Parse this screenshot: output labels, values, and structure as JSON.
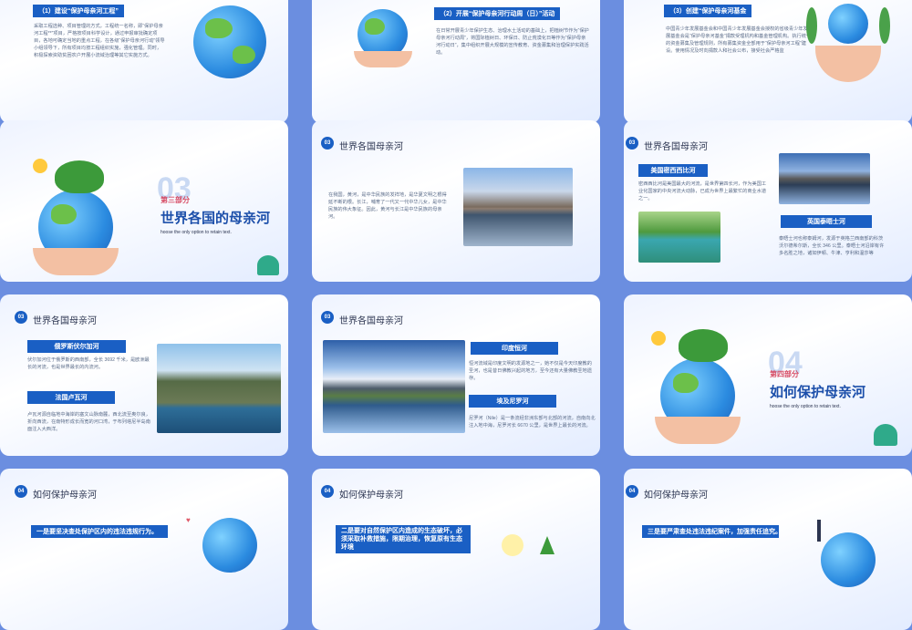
{
  "slides": {
    "s1": {
      "ribbon": "（1）建设“保护母亲河工程”",
      "text": "采取工程选种、项目管理的方式，工程统一名称，即“保护母亲河工程**”项目，严格按项目科学设计，通过申报审批确定项目，各地可确定当地的重点工程，在各级“保护母亲河行动”领导小组领导下，所有项目均按工程组织实施，强化管理。同时，积极探索资助贫困农户开展小流域治理等其它实施方式。"
    },
    "s2": {
      "ribbon": "（2）开展“保护母亲河行动周（日）”活动",
      "text": "在日常开展青少年保护生态、治理水土活动的基础上，把植树节作为“保护母亲河行动周”，将国际植树日、环保日、防止荒漠化日等作为“保护母亲河行动日”，集中组织开展大规模的宣传教育、资金募集和治理保护实践活动。"
    },
    "s3": {
      "ribbon": "（3）创建“保护母亲河基金",
      "text": "中国青少年发展基金会和中国青少年发展基金会授权的省级青少年发展基金会是“保护母亲河基金”捐款受理机构和基金管理机构。执行统一的资金募集及管理规则，所有募集资金全部用于“保护母亲河工程”建设。使用情况及时向捐款人和社会公布，接受社会严格监"
    },
    "s4": {
      "num": "03",
      "part": "第三部分",
      "title": "世界各国的母亲河",
      "sub": "hoose the only option to retain text."
    },
    "s5": {
      "badge": "03",
      "title": "世界各国母亲河",
      "text": "在我国，黄河，是中华民族的发祥地，是华夏文明之根得延不断的根。长江，哺育了一代又一代中华儿女，是中华民族的伟大象征。因此，黄河与长江是中华民族的母亲河。"
    },
    "s6": {
      "badge": "03",
      "title": "世界各国母亲河",
      "r1": "美国密西西比河",
      "t1": "密西西比河是美国最大的河流，是世界第四长河，作为美国工业化国家的中央河流大动脉，已成为世界上最繁忙的商业水道之一。",
      "r2": "英国泰晤士河",
      "t2": "泰晤士河也称泰姆河，发源于英格兰西南部的科茨沃尔德希尔斯，全长 346 公里。泰晤士河沿岸有许多名胜之地，诸如伊顿、牛津、亨利和温莎等"
    },
    "s7": {
      "badge": "03",
      "title": "世界各国母亲河",
      "r1": "俄罗斯伏尔加河",
      "t1": "伏尔加河位于俄罗斯的西南部，全长 3692 千米，是欧洲最长的河流，也是世界最长的内流河。",
      "r2": "法国卢瓦河",
      "t2": "卢瓦河源自临地中海岸的塞文山脉南麓，西北流至奥尔良，折向西流，在南特形成长而宽的河口湾，于布列塔尼半岛南面注入大西洋。"
    },
    "s8": {
      "badge": "03",
      "title": "世界各国母亲河",
      "r1": "印度恒河",
      "t1": "恒河流域是印度文明的发源地之一，她不仅是今天印度教的圣河，也是昔日佛教兴起的地方，至今还有大量佛教圣地遗存。",
      "r2": "埃及尼罗河",
      "t2": "尼罗河（Nile）是一条流经非洲东部与北部的河流，自南向北注入地中海，尼罗河长 6670 公里，是世界上最长的河流。"
    },
    "s9": {
      "num": "04",
      "part": "第四部分",
      "title": "如何保护母亲河",
      "sub": "hoose the only option to retain text."
    },
    "s10": {
      "badge": "04",
      "title": "如何保护母亲河",
      "r1": "一是要坚决查处保护区内的违法违规行为。"
    },
    "s11": {
      "badge": "04",
      "title": "如何保护母亲河",
      "r1": "二是要对自然保护区内造成的生态破坏，必须采取补救措施，限期治理，恢复原有生态环境"
    },
    "s12": {
      "badge": "04",
      "title": "如何保护母亲河",
      "r1": "三是要严肃查处违法违纪案件，加强责任追究。"
    }
  },
  "colors": {
    "background": "#6b8ee0",
    "ribbon": "#1a5fc4",
    "accent_red": "#d64a63"
  }
}
